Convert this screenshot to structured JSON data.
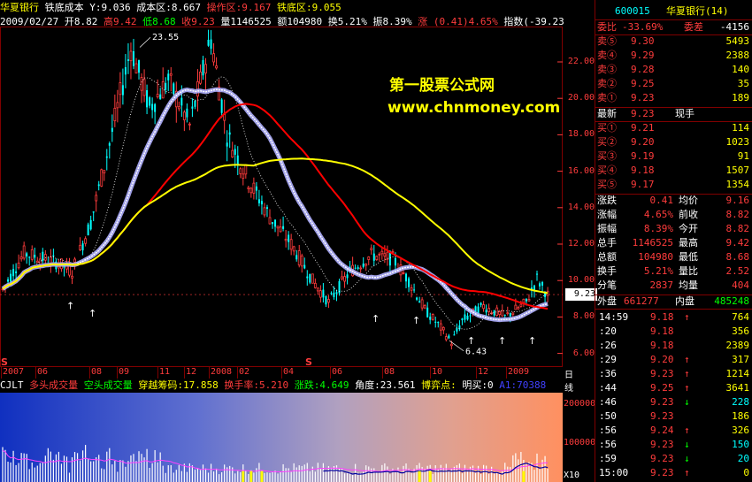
{
  "header": {
    "stock_name": "华夏银行",
    "indicator_name": "铁底成本",
    "y_label": "Y:9.036",
    "cost_zone": "成本区:8.667",
    "op_zone": "操作区:9.167",
    "bottom_zone": "铁底区:9.055",
    "date": "2009/02/27",
    "open": "开8.82",
    "high": "高9.42",
    "low": "低8.68",
    "close": "收9.23",
    "volume": "量1146525",
    "amount": "额104980",
    "turnover": "换5.21%",
    "amplitude": "振8.39%",
    "change": "涨 (0.41)4.65%",
    "index": "指数(-39.23"
  },
  "price_axis": [
    "22.00",
    "20.00",
    "18.00",
    "16.00",
    "14.00",
    "12.00",
    "10.00",
    "8.00",
    "6.00"
  ],
  "current_price_tag": "9.23",
  "annotations": {
    "high": "23.55",
    "low": "6.43"
  },
  "time_axis": [
    "2007",
    "06",
    "08",
    "09",
    "11",
    "12",
    "2008",
    "02",
    "04",
    "06",
    "08",
    "10",
    "12",
    "2009",
    "日线"
  ],
  "volume_header": {
    "prefix": "CJLT",
    "label1": "多头成交量",
    "label2": "空头成交量",
    "label3": "穿越筹码:17.858",
    "label4": "换手率:5.210",
    "label5": "涨跌:4.649",
    "label6": "角度:23.561",
    "label7": "博弈点:",
    "label8": "明买:0",
    "label9": "A1:70388"
  },
  "volume_axis": [
    "200000",
    "100000",
    "X10"
  ],
  "watermark": {
    "line1": "第一股票公式网",
    "line2": "www.chnmoney.com"
  },
  "right_panel": {
    "code": "600015",
    "name": "华夏银行(14)",
    "weibi_label": "委比",
    "weibi_value": "-33.69%",
    "weicha_label": "委差",
    "weicha_value": "-4156",
    "sells": [
      {
        "label": "卖⑤",
        "price": "9.30",
        "vol": "5493"
      },
      {
        "label": "卖④",
        "price": "9.29",
        "vol": "2388"
      },
      {
        "label": "卖③",
        "price": "9.28",
        "vol": "140"
      },
      {
        "label": "卖②",
        "price": "9.25",
        "vol": "35"
      },
      {
        "label": "卖①",
        "price": "9.23",
        "vol": "189"
      }
    ],
    "latest_label": "最新",
    "latest_value": "9.23",
    "xianshou_label": "现手",
    "buys": [
      {
        "label": "买①",
        "price": "9.21",
        "vol": "114"
      },
      {
        "label": "买②",
        "price": "9.20",
        "vol": "1023"
      },
      {
        "label": "买③",
        "price": "9.19",
        "vol": "91"
      },
      {
        "label": "买④",
        "price": "9.18",
        "vol": "1507"
      },
      {
        "label": "买⑤",
        "price": "9.17",
        "vol": "1354"
      }
    ],
    "stats": [
      {
        "l1": "涨跌",
        "v1": "0.41",
        "l2": "均价",
        "v2": "9.16"
      },
      {
        "l1": "涨幅",
        "v1": "4.65%",
        "l2": "前收",
        "v2": "8.82"
      },
      {
        "l1": "振幅",
        "v1": "8.39%",
        "l2": "今开",
        "v2": "8.82"
      },
      {
        "l1": "总手",
        "v1": "1146525",
        "l2": "最高",
        "v2": "9.42"
      },
      {
        "l1": "总额",
        "v1": "104980",
        "l2": "最低",
        "v2": "8.68"
      },
      {
        "l1": "换手",
        "v1": "5.21%",
        "l2": "量比",
        "v2": "2.52"
      },
      {
        "l1": "分笔",
        "v1": "2837",
        "l2": "均量",
        "v2": "404"
      }
    ],
    "outer_label": "外盘",
    "outer_value": "661277",
    "inner_label": "内盘",
    "inner_value": "485248",
    "ticks": [
      {
        "time": "14:59",
        "price": "9.18",
        "dir": "↑",
        "vol": "764"
      },
      {
        "time": ":20",
        "price": "9.18",
        "dir": "",
        "vol": "356"
      },
      {
        "time": ":26",
        "price": "9.18",
        "dir": "",
        "vol": "2389"
      },
      {
        "time": ":29",
        "price": "9.20",
        "dir": "↑",
        "vol": "317"
      },
      {
        "time": ":36",
        "price": "9.23",
        "dir": "↑",
        "vol": "1214"
      },
      {
        "time": ":44",
        "price": "9.25",
        "dir": "↑",
        "vol": "3641"
      },
      {
        "time": ":46",
        "price": "9.23",
        "dir": "↓",
        "vol": "228"
      },
      {
        "time": ":50",
        "price": "9.23",
        "dir": "",
        "vol": "186"
      },
      {
        "time": ":56",
        "price": "9.24",
        "dir": "↑",
        "vol": "326"
      },
      {
        "time": ":56",
        "price": "9.23",
        "dir": "↓",
        "vol": "150"
      },
      {
        "time": ":59",
        "price": "9.23",
        "dir": "↓",
        "vol": "20"
      },
      {
        "time": "15:00",
        "price": "9.23",
        "dir": "↑",
        "vol": "0"
      }
    ]
  },
  "colors": {
    "up": "#ff3c3c",
    "down": "#00ffff",
    "ma_white": "#ffffff",
    "ma_red": "#ff0000",
    "ma_yellow": "#ffff00",
    "grid": "#800000"
  }
}
